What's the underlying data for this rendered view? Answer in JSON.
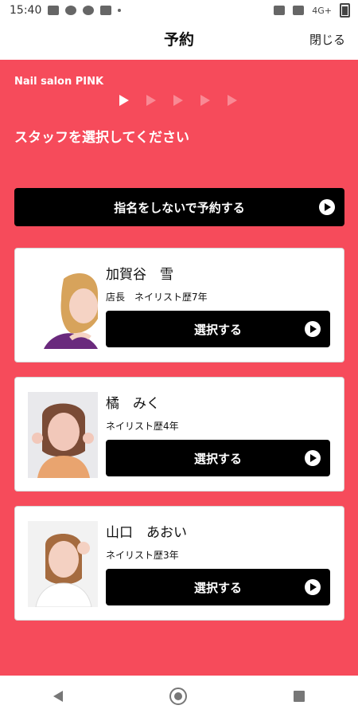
{
  "status_bar": {
    "time": "15:40",
    "network": "4G+"
  },
  "appbar": {
    "title": "予約",
    "close_label": "閉じる"
  },
  "salon": {
    "name": "Nail salon PINK"
  },
  "prompt": "スタッフを選択してください",
  "no_nominate_label": "指名をしないで予約する",
  "staff": [
    {
      "name": "加賀谷　雪",
      "desc": "店長　ネイリスト歴7年",
      "button_label": "選択する"
    },
    {
      "name": "橘　みく",
      "desc": "ネイリスト歴4年",
      "button_label": "選択する"
    },
    {
      "name": "山口　あおい",
      "desc": "ネイリスト歴3年",
      "button_label": "選択する"
    }
  ],
  "colors": {
    "accent": "#f64b5b",
    "button": "#000000"
  },
  "icons": [
    "image-icon",
    "message-icon",
    "line-icon",
    "person-icon",
    "mute-icon",
    "no-alarm-icon",
    "battery-icon",
    "play-arrow-icon",
    "back-icon",
    "home-icon",
    "recent-apps-icon"
  ]
}
